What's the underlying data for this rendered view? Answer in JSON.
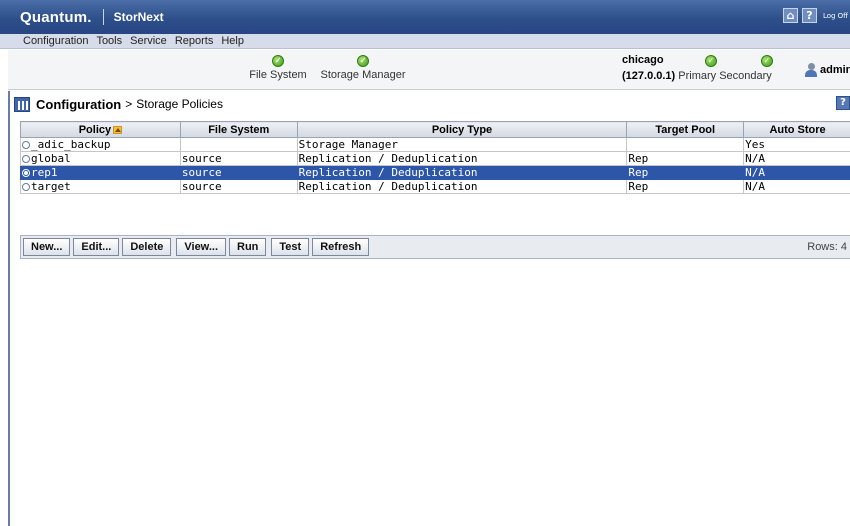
{
  "brand": {
    "name": "Quantum.",
    "product": "StorNext",
    "logoff": "Log Off"
  },
  "top_icons": [
    "home-icon",
    "help-icon"
  ],
  "menu": [
    "Configuration",
    "Tools",
    "Service",
    "Reports",
    "Help"
  ],
  "status": {
    "file_system": "File System",
    "storage_manager": "Storage Manager",
    "host": "chicago",
    "ip": "(127.0.0.1)",
    "primary": "Primary",
    "secondary": "Secondary",
    "user": "admin"
  },
  "page": {
    "title": "Configuration",
    "separator": ">",
    "crumb": "Storage Policies",
    "help": "?"
  },
  "table": {
    "columns": [
      "Policy",
      "File System",
      "Policy Type",
      "Target Pool",
      "Auto Store"
    ],
    "rows": [
      {
        "policy": "_adic_backup",
        "fs": "",
        "type": "Storage Manager",
        "pool": "",
        "auto": "Yes"
      },
      {
        "policy": "global",
        "fs": "source",
        "type": "Replication / Deduplication",
        "pool": "Rep",
        "auto": "N/A"
      },
      {
        "policy": "rep1",
        "fs": "source",
        "type": "Replication / Deduplication",
        "pool": "Rep",
        "auto": "N/A"
      },
      {
        "policy": "target",
        "fs": "source",
        "type": "Replication / Deduplication",
        "pool": "Rep",
        "auto": "N/A"
      }
    ],
    "selected_row": 2
  },
  "toolbar": {
    "new": "New...",
    "edit": "Edit...",
    "delete": "Delete",
    "view": "View...",
    "run": "Run",
    "test": "Test",
    "refresh": "Refresh",
    "rows": "Rows: 4"
  },
  "colors": {
    "header": "#2d4f8a",
    "selection": "#2e56a8",
    "ok": "#3c9a17"
  }
}
